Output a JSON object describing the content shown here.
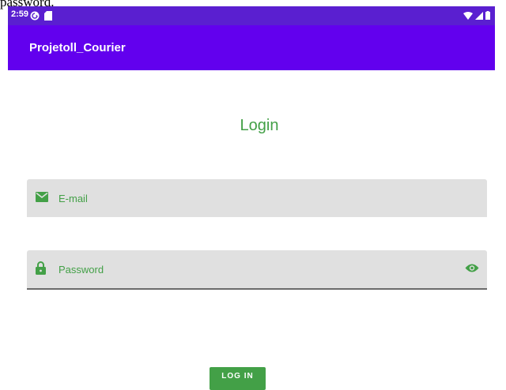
{
  "caption": "password.",
  "status_bar": {
    "time": "2:59"
  },
  "app_bar": {
    "title": "Projetoll_Courier"
  },
  "screen": {
    "title": "Login"
  },
  "form": {
    "email_placeholder": "E-mail",
    "password_placeholder": "Password",
    "login_label": "LOG IN"
  },
  "colors": {
    "status_bar": "#5a1fd0",
    "app_bar": "#6200ee",
    "accent_green": "#43a047",
    "field_background": "#e0e0e0"
  },
  "icons": {
    "status_left": [
      "refresh-circle-icon",
      "sd-card-icon"
    ],
    "status_right": [
      "wifi-icon",
      "signal-icon",
      "battery-icon"
    ],
    "email": "envelope-icon",
    "password": "lock-icon",
    "visibility": "eye-icon"
  }
}
